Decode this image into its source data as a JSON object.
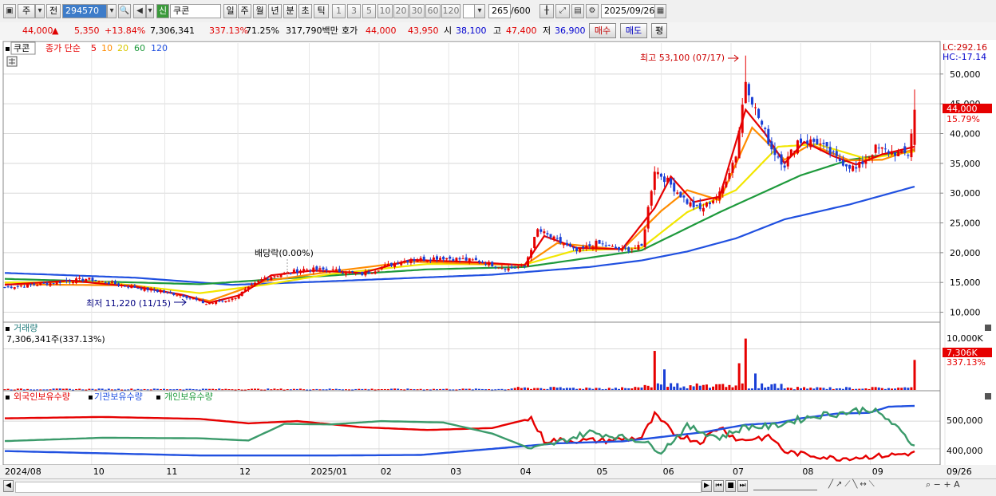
{
  "toolbar": {
    "mode_day": "주",
    "mode_prev": "전",
    "code": "294570",
    "market_badge": "신",
    "name": "쿠콘",
    "periods": [
      "일",
      "주",
      "월",
      "년",
      "분",
      "초",
      "틱"
    ],
    "active_period": "일",
    "intervals": [
      "1",
      "3",
      "5",
      "10",
      "20",
      "30",
      "60",
      "120"
    ],
    "count": "265",
    "count_max": "/600",
    "date": "2025/09/26"
  },
  "quote": {
    "price": "44,000",
    "arrow": "▲",
    "change": "5,350",
    "change_pct": "+13.84%",
    "volume": "7,306,341",
    "volume_ratio": "337.13%",
    "turnover": "71.25%",
    "amount": "317,790백만",
    "hoga_label": "호가",
    "ask": "44,000",
    "bid": "43,950",
    "open_label": "시",
    "open": "38,100",
    "high_label": "고",
    "high": "47,400",
    "low_label": "저",
    "low": "36,900",
    "buy_label": "매수",
    "sell_label": "매도",
    "eval_label": "평"
  },
  "legend": {
    "name": "쿠콘",
    "series_label": "종가 단순",
    "ma5": "5",
    "ma10": "10",
    "ma20": "20",
    "ma60": "60",
    "ma120": "120"
  },
  "annotations": {
    "high": "최고 53,100 (07/17)",
    "low": "최저 11,220 (11/15)",
    "dividend": "배당락(0.00%)",
    "lc": "LC:292.16",
    "hc": "HC:-17.14",
    "last_price": "44,000",
    "last_pct": "15.79%",
    "vol_title": "거래량",
    "vol_value": "7,306,341주(337.13%)",
    "vol_last": "7,306K",
    "vol_last_pct": "337.13%",
    "holders_foreign": "외국인보유수량",
    "holders_inst": "기관보유수량",
    "holders_indiv": "개인보유수량"
  },
  "colors": {
    "up": "#e60000",
    "down": "#1a3fd6",
    "ma5": "#e60000",
    "ma10": "#ff8c00",
    "ma20": "#f2e600",
    "ma60": "#1e9a3c",
    "ma120": "#2050e0",
    "foreign": "#e60000",
    "inst": "#2050e0",
    "indiv": "#3a9a6a"
  },
  "chart_data": [
    {
      "type": "candlestick",
      "title": "쿠콘",
      "y_axis_ticks": [
        "10,000",
        "15,000",
        "20,000",
        "25,000",
        "30,000",
        "35,000",
        "40,000",
        "45,000",
        "50,000"
      ],
      "ylim": [
        8600,
        55200
      ],
      "x_axis_ticks": [
        "2024/08",
        "10",
        "11",
        "12",
        "2025/01",
        "02",
        "03",
        "04",
        "05",
        "06",
        "07",
        "08",
        "09",
        "09/26"
      ],
      "close_anchors": [
        [
          0,
          14200
        ],
        [
          12,
          14800
        ],
        [
          25,
          15600
        ],
        [
          40,
          14200
        ],
        [
          55,
          12800
        ],
        [
          62,
          11400
        ],
        [
          70,
          12200
        ],
        [
          80,
          15800
        ],
        [
          92,
          17200
        ],
        [
          100,
          17100
        ],
        [
          110,
          16400
        ],
        [
          122,
          18600
        ],
        [
          134,
          19200
        ],
        [
          146,
          18600
        ],
        [
          155,
          17300
        ],
        [
          160,
          17800
        ],
        [
          164,
          23800
        ],
        [
          170,
          22000
        ],
        [
          176,
          20200
        ],
        [
          182,
          21600
        ],
        [
          190,
          20400
        ],
        [
          196,
          21000
        ],
        [
          200,
          34000
        ],
        [
          204,
          32000
        ],
        [
          210,
          28500
        ],
        [
          214,
          27200
        ],
        [
          220,
          29800
        ],
        [
          225,
          36500
        ],
        [
          228,
          49000
        ],
        [
          231,
          44000
        ],
        [
          236,
          37500
        ],
        [
          240,
          34800
        ],
        [
          244,
          38800
        ],
        [
          250,
          38600
        ],
        [
          256,
          35800
        ],
        [
          262,
          34000
        ],
        [
          268,
          37500
        ],
        [
          274,
          36800
        ],
        [
          278,
          36500
        ],
        [
          280,
          44000
        ]
      ],
      "ma": {
        "ma5": [
          [
            0,
            14600
          ],
          [
            20,
            15300
          ],
          [
            40,
            14300
          ],
          [
            55,
            12900
          ],
          [
            63,
            11600
          ],
          [
            72,
            12800
          ],
          [
            82,
            16200
          ],
          [
            95,
            17000
          ],
          [
            110,
            16600
          ],
          [
            125,
            18800
          ],
          [
            145,
            18400
          ],
          [
            160,
            17900
          ],
          [
            166,
            22800
          ],
          [
            176,
            20800
          ],
          [
            190,
            20600
          ],
          [
            200,
            27500
          ],
          [
            205,
            32800
          ],
          [
            212,
            28500
          ],
          [
            220,
            29400
          ],
          [
            228,
            44000
          ],
          [
            234,
            40000
          ],
          [
            240,
            35000
          ],
          [
            246,
            38600
          ],
          [
            255,
            36200
          ],
          [
            262,
            34800
          ],
          [
            270,
            36500
          ],
          [
            280,
            37800
          ]
        ],
        "ma10": [
          [
            0,
            14700
          ],
          [
            40,
            14500
          ],
          [
            63,
            11900
          ],
          [
            80,
            15200
          ],
          [
            100,
            16800
          ],
          [
            125,
            18500
          ],
          [
            160,
            17900
          ],
          [
            170,
            21600
          ],
          [
            190,
            20500
          ],
          [
            202,
            27000
          ],
          [
            210,
            30500
          ],
          [
            220,
            28800
          ],
          [
            230,
            41000
          ],
          [
            240,
            35600
          ],
          [
            248,
            38200
          ],
          [
            260,
            35500
          ],
          [
            270,
            35600
          ],
          [
            280,
            37400
          ]
        ],
        "ma20": [
          [
            0,
            15000
          ],
          [
            30,
            15100
          ],
          [
            60,
            13200
          ],
          [
            80,
            14600
          ],
          [
            100,
            16400
          ],
          [
            130,
            18100
          ],
          [
            160,
            18000
          ],
          [
            175,
            20300
          ],
          [
            196,
            20800
          ],
          [
            210,
            26800
          ],
          [
            225,
            30500
          ],
          [
            238,
            37800
          ],
          [
            250,
            38200
          ],
          [
            265,
            35800
          ],
          [
            280,
            37000
          ]
        ],
        "ma60": [
          [
            0,
            15600
          ],
          [
            60,
            14700
          ],
          [
            90,
            15800
          ],
          [
            130,
            17200
          ],
          [
            160,
            17600
          ],
          [
            196,
            20400
          ],
          [
            220,
            26800
          ],
          [
            245,
            33000
          ],
          [
            260,
            35600
          ],
          [
            280,
            37200
          ]
        ],
        "ma120": [
          [
            0,
            16600
          ],
          [
            40,
            15800
          ],
          [
            70,
            14600
          ],
          [
            100,
            15200
          ],
          [
            150,
            16300
          ],
          [
            180,
            17600
          ],
          [
            196,
            18700
          ],
          [
            210,
            20200
          ],
          [
            225,
            22400
          ],
          [
            240,
            25600
          ],
          [
            260,
            28100
          ],
          [
            280,
            31100
          ]
        ]
      },
      "high": {
        "value": 53100,
        "date": "07/17"
      },
      "low": {
        "value": 11220,
        "date": "11/15"
      }
    },
    {
      "type": "bar",
      "title": "거래량",
      "y_axis_ticks": [
        "10,000K"
      ],
      "ylim": [
        0,
        13000
      ],
      "last": 7306,
      "spikes": [
        [
          200,
          9500
        ],
        [
          203,
          5000
        ],
        [
          226,
          6500
        ],
        [
          228,
          12500
        ],
        [
          231,
          4000
        ],
        [
          280,
          7306
        ]
      ],
      "units": "K"
    },
    {
      "type": "line",
      "title": "보유수량",
      "y_axis_ticks": [
        "400,000",
        "500,000"
      ],
      "ylim": [
        345000,
        575000
      ],
      "series": [
        {
          "name": "외국인보유수량",
          "points": [
            [
              0,
              510000
            ],
            [
              30,
              515000
            ],
            [
              60,
              508000
            ],
            [
              75,
              492000
            ],
            [
              90,
              500000
            ],
            [
              110,
              478000
            ],
            [
              130,
              468000
            ],
            [
              150,
              475000
            ],
            [
              162,
              510000
            ],
            [
              166,
              430000
            ],
            [
              185,
              430000
            ],
            [
              196,
              440000
            ],
            [
              200,
              520000
            ],
            [
              206,
              455000
            ],
            [
              214,
              425000
            ],
            [
              220,
              480000
            ],
            [
              226,
              430000
            ],
            [
              232,
              440000
            ],
            [
              236,
              440000
            ],
            [
              240,
              390000
            ],
            [
              246,
              380000
            ],
            [
              256,
              365000
            ],
            [
              270,
              375000
            ],
            [
              280,
              385000
            ]
          ]
        },
        {
          "name": "기관보유수량",
          "points": [
            [
              0,
              392000
            ],
            [
              60,
              376000
            ],
            [
              100,
              376000
            ],
            [
              128,
              378000
            ],
            [
              136,
              386000
            ],
            [
              150,
              400000
            ],
            [
              160,
              410000
            ],
            [
              170,
              420000
            ],
            [
              190,
              427000
            ],
            [
              200,
              440000
            ],
            [
              215,
              460000
            ],
            [
              228,
              487000
            ],
            [
              238,
              494000
            ],
            [
              245,
              510000
            ],
            [
              256,
              527000
            ],
            [
              266,
              530000
            ],
            [
              272,
              552000
            ],
            [
              280,
              555000
            ]
          ]
        },
        {
          "name": "개인보유수량",
          "points": [
            [
              0,
              428000
            ],
            [
              30,
              440000
            ],
            [
              60,
              438000
            ],
            [
              75,
              430000
            ],
            [
              86,
              490000
            ],
            [
              100,
              488000
            ],
            [
              116,
              500000
            ],
            [
              135,
              495000
            ],
            [
              150,
              455000
            ],
            [
              162,
              400000
            ],
            [
              168,
              415000
            ],
            [
              180,
              460000
            ],
            [
              196,
              430000
            ],
            [
              202,
              390000
            ],
            [
              210,
              480000
            ],
            [
              220,
              440000
            ],
            [
              228,
              480000
            ],
            [
              236,
              480000
            ],
            [
              242,
              500000
            ],
            [
              250,
              520000
            ],
            [
              258,
              530000
            ],
            [
              266,
              545000
            ],
            [
              272,
              505000
            ],
            [
              280,
              410000
            ]
          ]
        }
      ]
    }
  ]
}
